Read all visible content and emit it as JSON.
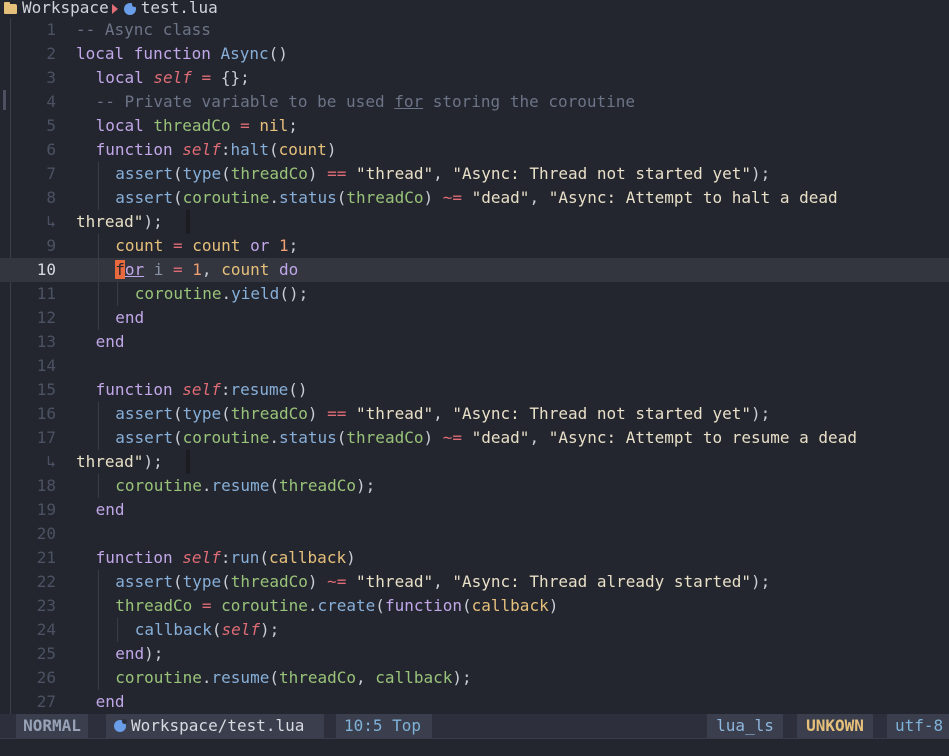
{
  "winbar": {
    "root": "Workspace",
    "file": "test.lua"
  },
  "lines": [
    {
      "n": "1",
      "indent": 0,
      "tokens": [
        [
          "cm",
          "-- Async class"
        ]
      ]
    },
    {
      "n": "2",
      "indent": 0,
      "tokens": [
        [
          "kw",
          "local "
        ],
        [
          "kw",
          "function "
        ],
        [
          "fn",
          "Async"
        ],
        [
          "pl",
          "()"
        ]
      ]
    },
    {
      "n": "3",
      "indent": 1,
      "tokens": [
        [
          "kw",
          "local "
        ],
        [
          "se",
          "self"
        ],
        [
          "op",
          " = "
        ],
        [
          "pl",
          "{};"
        ]
      ]
    },
    {
      "n": "4",
      "indent": 1,
      "tokens": [
        [
          "cm",
          "-- Private variable to be used "
        ],
        [
          "cm ul",
          "for"
        ],
        [
          "cm",
          " storing the coroutine"
        ]
      ]
    },
    {
      "n": "5",
      "indent": 1,
      "tokens": [
        [
          "kw",
          "local "
        ],
        [
          "gr",
          "threadCo"
        ],
        [
          "op",
          " = "
        ],
        [
          "nl",
          "nil"
        ],
        [
          "pl",
          ";"
        ]
      ]
    },
    {
      "n": "6",
      "indent": 1,
      "tokens": [
        [
          "kw",
          "function "
        ],
        [
          "se",
          "self"
        ],
        [
          "pl",
          ":"
        ],
        [
          "fn",
          "halt"
        ],
        [
          "pl",
          "("
        ],
        [
          "pa",
          "count"
        ],
        [
          "pl",
          ")"
        ]
      ]
    },
    {
      "n": "7",
      "indent": 2,
      "tokens": [
        [
          "fn",
          "assert"
        ],
        [
          "pl",
          "("
        ],
        [
          "fn",
          "type"
        ],
        [
          "pl",
          "("
        ],
        [
          "gr",
          "threadCo"
        ],
        [
          "pl",
          ") "
        ],
        [
          "op",
          "=="
        ],
        [
          "pl",
          " "
        ],
        [
          "st",
          "\"thread\""
        ],
        [
          "pl",
          ", "
        ],
        [
          "st",
          "\"Async: Thread not started yet\""
        ],
        [
          "pl",
          ");"
        ]
      ]
    },
    {
      "n": "8",
      "indent": 2,
      "tokens": [
        [
          "fn",
          "assert"
        ],
        [
          "pl",
          "("
        ],
        [
          "gr",
          "coroutine"
        ],
        [
          "pl",
          "."
        ],
        [
          "fn",
          "status"
        ],
        [
          "pl",
          "("
        ],
        [
          "gr",
          "threadCo"
        ],
        [
          "pl",
          ") "
        ],
        [
          "op",
          "~="
        ],
        [
          "pl",
          " "
        ],
        [
          "st",
          "\"dead\""
        ],
        [
          "pl",
          ", "
        ],
        [
          "st",
          "\"Async: Attempt to halt a dead"
        ]
      ]
    },
    {
      "n": "↳",
      "indent": 0,
      "wrap": true,
      "tokens": [
        [
          "st",
          "thread\""
        ],
        [
          "pl",
          ");"
        ]
      ]
    },
    {
      "n": "9",
      "indent": 2,
      "tokens": [
        [
          "pa",
          "count"
        ],
        [
          "op",
          " = "
        ],
        [
          "pa",
          "count"
        ],
        [
          "kw",
          " or "
        ],
        [
          "nu",
          "1"
        ],
        [
          "pl",
          ";"
        ]
      ]
    },
    {
      "n": "10",
      "indent": 2,
      "current": true,
      "tokens": [
        [
          "cursor",
          "f"
        ],
        [
          "kw ul",
          "or"
        ],
        [
          "pl",
          " "
        ],
        [
          "dim",
          "i"
        ],
        [
          "op",
          " = "
        ],
        [
          "nu",
          "1"
        ],
        [
          "pl",
          ", "
        ],
        [
          "pa",
          "count"
        ],
        [
          "kw",
          " do"
        ]
      ]
    },
    {
      "n": "11",
      "indent": 3,
      "tokens": [
        [
          "gr",
          "coroutine"
        ],
        [
          "pl",
          "."
        ],
        [
          "fn",
          "yield"
        ],
        [
          "pl",
          "();"
        ]
      ]
    },
    {
      "n": "12",
      "indent": 2,
      "tokens": [
        [
          "kw",
          "end"
        ]
      ]
    },
    {
      "n": "13",
      "indent": 1,
      "tokens": [
        [
          "kw",
          "end"
        ]
      ]
    },
    {
      "n": "14",
      "indent": 1,
      "tokens": []
    },
    {
      "n": "15",
      "indent": 1,
      "tokens": [
        [
          "kw",
          "function "
        ],
        [
          "se",
          "self"
        ],
        [
          "pl",
          ":"
        ],
        [
          "fn",
          "resume"
        ],
        [
          "pl",
          "()"
        ]
      ]
    },
    {
      "n": "16",
      "indent": 2,
      "tokens": [
        [
          "fn",
          "assert"
        ],
        [
          "pl",
          "("
        ],
        [
          "fn",
          "type"
        ],
        [
          "pl",
          "("
        ],
        [
          "gr",
          "threadCo"
        ],
        [
          "pl",
          ") "
        ],
        [
          "op",
          "=="
        ],
        [
          "pl",
          " "
        ],
        [
          "st",
          "\"thread\""
        ],
        [
          "pl",
          ", "
        ],
        [
          "st",
          "\"Async: Thread not started yet\""
        ],
        [
          "pl",
          ");"
        ]
      ]
    },
    {
      "n": "17",
      "indent": 2,
      "tokens": [
        [
          "fn",
          "assert"
        ],
        [
          "pl",
          "("
        ],
        [
          "gr",
          "coroutine"
        ],
        [
          "pl",
          "."
        ],
        [
          "fn",
          "status"
        ],
        [
          "pl",
          "("
        ],
        [
          "gr",
          "threadCo"
        ],
        [
          "pl",
          ") "
        ],
        [
          "op",
          "~="
        ],
        [
          "pl",
          " "
        ],
        [
          "st",
          "\"dead\""
        ],
        [
          "pl",
          ", "
        ],
        [
          "st",
          "\"Async: Attempt to resume a dead"
        ]
      ]
    },
    {
      "n": "↳",
      "indent": 0,
      "wrap": true,
      "tokens": [
        [
          "st",
          "thread\""
        ],
        [
          "pl",
          ");"
        ]
      ]
    },
    {
      "n": "18",
      "indent": 2,
      "tokens": [
        [
          "gr",
          "coroutine"
        ],
        [
          "pl",
          "."
        ],
        [
          "fn",
          "resume"
        ],
        [
          "pl",
          "("
        ],
        [
          "gr",
          "threadCo"
        ],
        [
          "pl",
          ");"
        ]
      ]
    },
    {
      "n": "19",
      "indent": 1,
      "tokens": [
        [
          "kw",
          "end"
        ]
      ]
    },
    {
      "n": "20",
      "indent": 1,
      "tokens": []
    },
    {
      "n": "21",
      "indent": 1,
      "tokens": [
        [
          "kw",
          "function "
        ],
        [
          "se",
          "self"
        ],
        [
          "pl",
          ":"
        ],
        [
          "fn",
          "run"
        ],
        [
          "pl",
          "("
        ],
        [
          "pa",
          "callback"
        ],
        [
          "pl",
          ")"
        ]
      ]
    },
    {
      "n": "22",
      "indent": 2,
      "tokens": [
        [
          "fn",
          "assert"
        ],
        [
          "pl",
          "("
        ],
        [
          "fn",
          "type"
        ],
        [
          "pl",
          "("
        ],
        [
          "gr",
          "threadCo"
        ],
        [
          "pl",
          ") "
        ],
        [
          "op",
          "~="
        ],
        [
          "pl",
          " "
        ],
        [
          "st",
          "\"thread\""
        ],
        [
          "pl",
          ", "
        ],
        [
          "st",
          "\"Async: Thread already started\""
        ],
        [
          "pl",
          ");"
        ]
      ]
    },
    {
      "n": "23",
      "indent": 2,
      "tokens": [
        [
          "gr",
          "threadCo"
        ],
        [
          "op",
          " = "
        ],
        [
          "gr",
          "coroutine"
        ],
        [
          "pl",
          "."
        ],
        [
          "fn",
          "create"
        ],
        [
          "pl",
          "("
        ],
        [
          "kw",
          "function"
        ],
        [
          "pl",
          "("
        ],
        [
          "pa",
          "callback"
        ],
        [
          "pl",
          ")"
        ]
      ]
    },
    {
      "n": "24",
      "indent": 3,
      "tokens": [
        [
          "fn",
          "callback"
        ],
        [
          "pl",
          "("
        ],
        [
          "se",
          "self"
        ],
        [
          "pl",
          ");"
        ]
      ]
    },
    {
      "n": "25",
      "indent": 2,
      "tokens": [
        [
          "kw",
          "end"
        ],
        [
          "pl",
          ");"
        ]
      ]
    },
    {
      "n": "26",
      "indent": 2,
      "tokens": [
        [
          "gr",
          "coroutine"
        ],
        [
          "pl",
          "."
        ],
        [
          "fn",
          "resume"
        ],
        [
          "pl",
          "("
        ],
        [
          "gr",
          "threadCo"
        ],
        [
          "pl",
          ", "
        ],
        [
          "gr",
          "callback"
        ],
        [
          "pl",
          ");"
        ]
      ]
    },
    {
      "n": "27",
      "indent": 1,
      "tokens": [
        [
          "kw",
          "end"
        ]
      ]
    }
  ],
  "status": {
    "mode": "NORMAL",
    "file": "Workspace/test.lua",
    "position": "10:5 Top",
    "lsp": "lua_ls",
    "encoding_state": "UNKOWN",
    "encoding": "utf-8"
  },
  "colors": {
    "background": "#24262f",
    "cursor": "#e8693b",
    "statusline": "#2d303c"
  },
  "icons": {
    "root": "folder-icon",
    "separator": "chevron-right-icon",
    "file": "lua-file-icon"
  }
}
